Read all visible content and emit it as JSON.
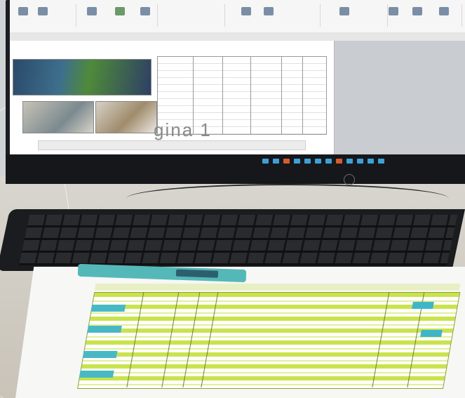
{
  "photo": {
    "monitor": {
      "document_page_label": "gina 1",
      "taskbar_icon_count": 12
    },
    "colors": {
      "screen": "#f3f3f3",
      "monitor_bezel": "#15171b",
      "keyboard": "#1b1c1f",
      "usb_stick": "#55b8b8",
      "sheet_highlight": "#c9e34d",
      "sheet_cyan": "#48b9c4"
    }
  }
}
